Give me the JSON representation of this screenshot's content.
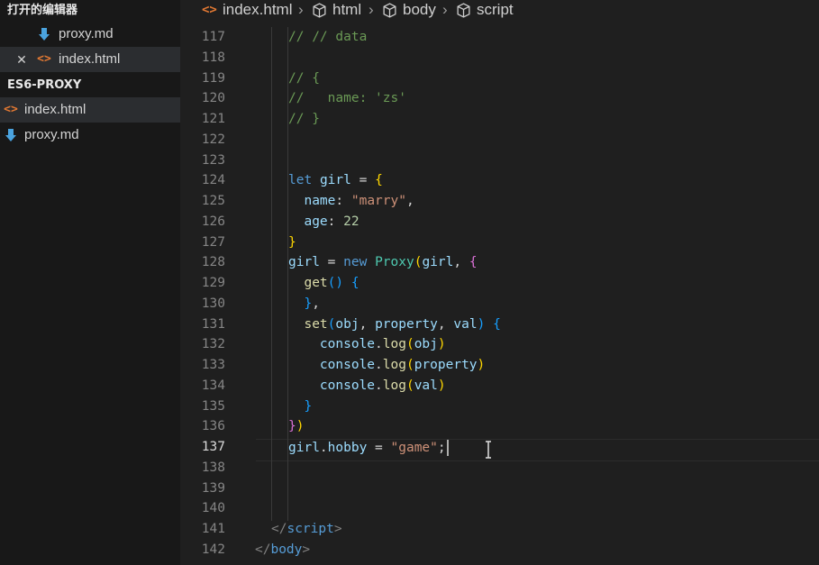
{
  "sidebar": {
    "open_editors_title": "打开的编辑器",
    "open_editors": [
      {
        "icon": "markdown-icon",
        "label": "proxy.md",
        "active": false,
        "has_close": false
      },
      {
        "icon": "html-icon",
        "label": "index.html",
        "active": true,
        "has_close": true
      }
    ],
    "folder_title": "ES6-PROXY",
    "files": [
      {
        "icon": "html-icon",
        "label": "index.html",
        "active": true
      },
      {
        "icon": "markdown-icon",
        "label": "proxy.md",
        "active": false
      }
    ]
  },
  "breadcrumb": {
    "file": "index.html",
    "items": [
      "html",
      "body",
      "script"
    ]
  },
  "editor": {
    "current_line": 137,
    "lines": [
      {
        "n": 117,
        "tokens": [
          [
            "c",
            "// // data"
          ]
        ]
      },
      {
        "n": 118,
        "tokens": []
      },
      {
        "n": 119,
        "tokens": [
          [
            "c",
            "// {"
          ]
        ]
      },
      {
        "n": 120,
        "tokens": [
          [
            "c",
            "//   name: 'zs'"
          ]
        ]
      },
      {
        "n": 121,
        "tokens": [
          [
            "c",
            "// }"
          ]
        ]
      },
      {
        "n": 122,
        "tokens": []
      },
      {
        "n": 123,
        "tokens": []
      },
      {
        "n": 124,
        "tokens": [
          [
            "k",
            "let"
          ],
          [
            "o",
            " "
          ],
          [
            "v",
            "girl"
          ],
          [
            "o",
            " = "
          ],
          [
            "b1",
            "{"
          ]
        ]
      },
      {
        "n": 125,
        "tokens": [
          [
            "o",
            "  "
          ],
          [
            "p",
            "name"
          ],
          [
            "o",
            ": "
          ],
          [
            "s",
            "\"marry\""
          ],
          [
            "o",
            ","
          ]
        ]
      },
      {
        "n": 126,
        "tokens": [
          [
            "o",
            "  "
          ],
          [
            "p",
            "age"
          ],
          [
            "o",
            ": "
          ],
          [
            "n",
            "22"
          ]
        ]
      },
      {
        "n": 127,
        "tokens": [
          [
            "b1",
            "}"
          ]
        ]
      },
      {
        "n": 128,
        "tokens": [
          [
            "v",
            "girl"
          ],
          [
            "o",
            " = "
          ],
          [
            "k",
            "new"
          ],
          [
            "o",
            " "
          ],
          [
            "cl",
            "Proxy"
          ],
          [
            "b1",
            "("
          ],
          [
            "v",
            "girl"
          ],
          [
            "o",
            ", "
          ],
          [
            "b2",
            "{"
          ]
        ]
      },
      {
        "n": 129,
        "tokens": [
          [
            "o",
            "  "
          ],
          [
            "f",
            "get"
          ],
          [
            "b3",
            "()"
          ],
          [
            "o",
            " "
          ],
          [
            "b3",
            "{"
          ]
        ]
      },
      {
        "n": 130,
        "tokens": [
          [
            "o",
            "  "
          ],
          [
            "b3",
            "}"
          ],
          [
            "o",
            ","
          ]
        ]
      },
      {
        "n": 131,
        "tokens": [
          [
            "o",
            "  "
          ],
          [
            "f",
            "set"
          ],
          [
            "b3",
            "("
          ],
          [
            "v",
            "obj"
          ],
          [
            "o",
            ", "
          ],
          [
            "v",
            "property"
          ],
          [
            "o",
            ", "
          ],
          [
            "v",
            "val"
          ],
          [
            "b3",
            ")"
          ],
          [
            "o",
            " "
          ],
          [
            "b3",
            "{"
          ]
        ]
      },
      {
        "n": 132,
        "tokens": [
          [
            "o",
            "    "
          ],
          [
            "v",
            "console"
          ],
          [
            "o",
            "."
          ],
          [
            "f",
            "log"
          ],
          [
            "b1",
            "("
          ],
          [
            "v",
            "obj"
          ],
          [
            "b1",
            ")"
          ]
        ]
      },
      {
        "n": 133,
        "tokens": [
          [
            "o",
            "    "
          ],
          [
            "v",
            "console"
          ],
          [
            "o",
            "."
          ],
          [
            "f",
            "log"
          ],
          [
            "b1",
            "("
          ],
          [
            "v",
            "property"
          ],
          [
            "b1",
            ")"
          ]
        ]
      },
      {
        "n": 134,
        "tokens": [
          [
            "o",
            "    "
          ],
          [
            "v",
            "console"
          ],
          [
            "o",
            "."
          ],
          [
            "f",
            "log"
          ],
          [
            "b1",
            "("
          ],
          [
            "v",
            "val"
          ],
          [
            "b1",
            ")"
          ]
        ]
      },
      {
        "n": 135,
        "tokens": [
          [
            "o",
            "  "
          ],
          [
            "b3",
            "}"
          ]
        ]
      },
      {
        "n": 136,
        "tokens": [
          [
            "b2",
            "}"
          ],
          [
            "b1",
            ")"
          ]
        ]
      },
      {
        "n": 137,
        "tokens": [
          [
            "v",
            "girl"
          ],
          [
            "o",
            "."
          ],
          [
            "p",
            "hobby"
          ],
          [
            "o",
            " = "
          ],
          [
            "s",
            "\"game\""
          ],
          [
            "o",
            ";"
          ]
        ]
      },
      {
        "n": 138,
        "tokens": []
      },
      {
        "n": 139,
        "tokens": []
      },
      {
        "n": 140,
        "tokens": []
      },
      {
        "n": 141,
        "tokens": [
          [
            "tb",
            "</"
          ],
          [
            "t",
            "script"
          ],
          [
            "tb",
            ">"
          ]
        ]
      },
      {
        "n": 142,
        "tokens": [
          [
            "tb",
            "</"
          ],
          [
            "t",
            "body"
          ],
          [
            "tb",
            ">"
          ]
        ]
      }
    ]
  },
  "colors": {
    "background": "#1f1f1f",
    "sidebar_bg": "#181818",
    "active_item": "#2b2d30",
    "line_number": "#858585",
    "comment": "#6a9955",
    "keyword": "#569cd6",
    "string": "#ce9178"
  }
}
